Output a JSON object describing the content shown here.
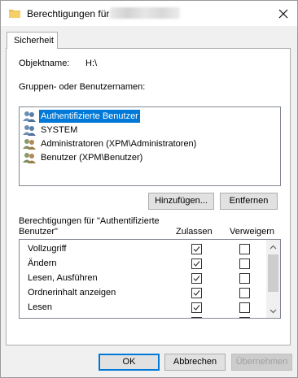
{
  "window": {
    "title": "Berechtigungen für",
    "close_label": "Schließen"
  },
  "tabs": [
    {
      "label": "Sicherheit",
      "active": true
    }
  ],
  "object": {
    "label": "Objektname:",
    "value": "H:\\"
  },
  "groups": {
    "label": "Gruppen- oder Benutzernamen:",
    "items": [
      {
        "label": "Authentifizierte Benutzer",
        "selected": true,
        "icon": "users-icon"
      },
      {
        "label": "SYSTEM",
        "selected": false,
        "icon": "users-icon"
      },
      {
        "label": "Administratoren (XPM\\Administratoren)",
        "selected": false,
        "icon": "users-icon"
      },
      {
        "label": "Benutzer (XPM\\Benutzer)",
        "selected": false,
        "icon": "users-icon"
      }
    ]
  },
  "buttons": {
    "add": "Hinzufügen...",
    "remove": "Entfernen",
    "ok": "OK",
    "cancel": "Abbrechen",
    "apply": "Übernehmen"
  },
  "permissions": {
    "label_line1": "Berechtigungen für \"Authentifizierte",
    "label_line2": "Benutzer\"",
    "col_allow": "Zulassen",
    "col_deny": "Verweigern",
    "rows": [
      {
        "name": "Vollzugriff",
        "allow": true,
        "deny": false
      },
      {
        "name": "Ändern",
        "allow": true,
        "deny": false
      },
      {
        "name": "Lesen, Ausführen",
        "allow": true,
        "deny": false
      },
      {
        "name": "Ordnerinhalt anzeigen",
        "allow": true,
        "deny": false
      },
      {
        "name": "Lesen",
        "allow": true,
        "deny": false
      },
      {
        "name": "",
        "allow": true,
        "deny": false
      }
    ]
  },
  "colors": {
    "selection": "#0078d7",
    "dialog_bg": "#f0f0f0",
    "button_bg": "#e1e1e1"
  }
}
